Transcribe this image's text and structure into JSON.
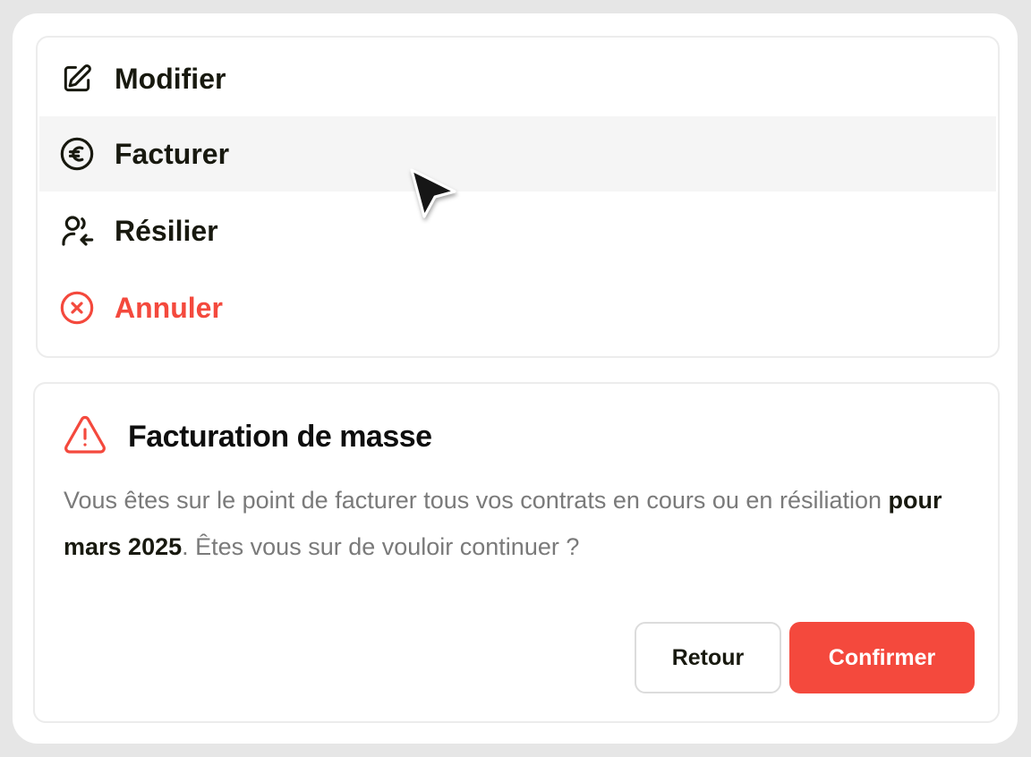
{
  "menu": {
    "items": [
      {
        "label": "Modifier",
        "icon": "edit-icon"
      },
      {
        "label": "Facturer",
        "icon": "euro-icon"
      },
      {
        "label": "Résilier",
        "icon": "user-return-icon"
      },
      {
        "label": "Annuler",
        "icon": "close-circle-icon"
      }
    ],
    "hovered_index": 1
  },
  "dialog": {
    "icon": "warning-icon",
    "title": "Facturation de masse",
    "text_before": "Vous êtes sur le point de facturer tous vos contrats en cours ou en résiliation ",
    "text_bold": "pour mars 2025",
    "text_after": ". Êtes vous sur de vouloir continuer ?",
    "back_label": "Retour",
    "confirm_label": "Confirmer"
  },
  "colors": {
    "accent": "#f4493d",
    "text": "#18190f",
    "muted": "#7a7a7a",
    "hover_bg": "#f5f5f5"
  }
}
